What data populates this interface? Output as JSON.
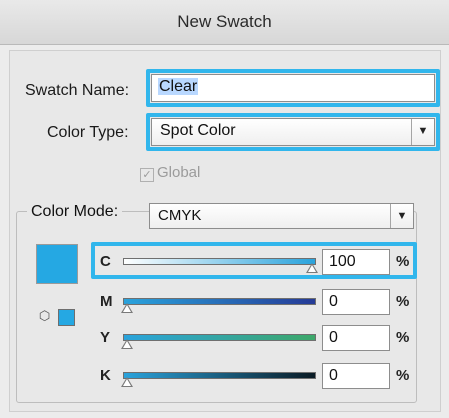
{
  "dialog": {
    "title": "New Swatch"
  },
  "swatch_name": {
    "label": "Swatch Name:",
    "value": "Clear"
  },
  "color_type": {
    "label": "Color Type:",
    "value": "Spot Color"
  },
  "global": {
    "label": "Global",
    "checked": true
  },
  "color_mode": {
    "label": "Color Mode:",
    "value": "CMYK"
  },
  "swatch_color": "#25a8e3",
  "highlight_color": "#31b6ec",
  "channels": [
    {
      "name": "C",
      "value": "100",
      "unit": "%",
      "level": 1.0,
      "gradient": [
        "#ffffff",
        "#2aa3dc"
      ]
    },
    {
      "name": "M",
      "value": "0",
      "unit": "%",
      "level": 0.0,
      "gradient": [
        "#2aa3dc",
        "#253a96"
      ]
    },
    {
      "name": "Y",
      "value": "0",
      "unit": "%",
      "level": 0.0,
      "gradient": [
        "#2aa3dc",
        "#3da86a"
      ]
    },
    {
      "name": "K",
      "value": "0",
      "unit": "%",
      "level": 0.0,
      "gradient": [
        "#2aa3dc",
        "#0a1a24"
      ]
    }
  ]
}
